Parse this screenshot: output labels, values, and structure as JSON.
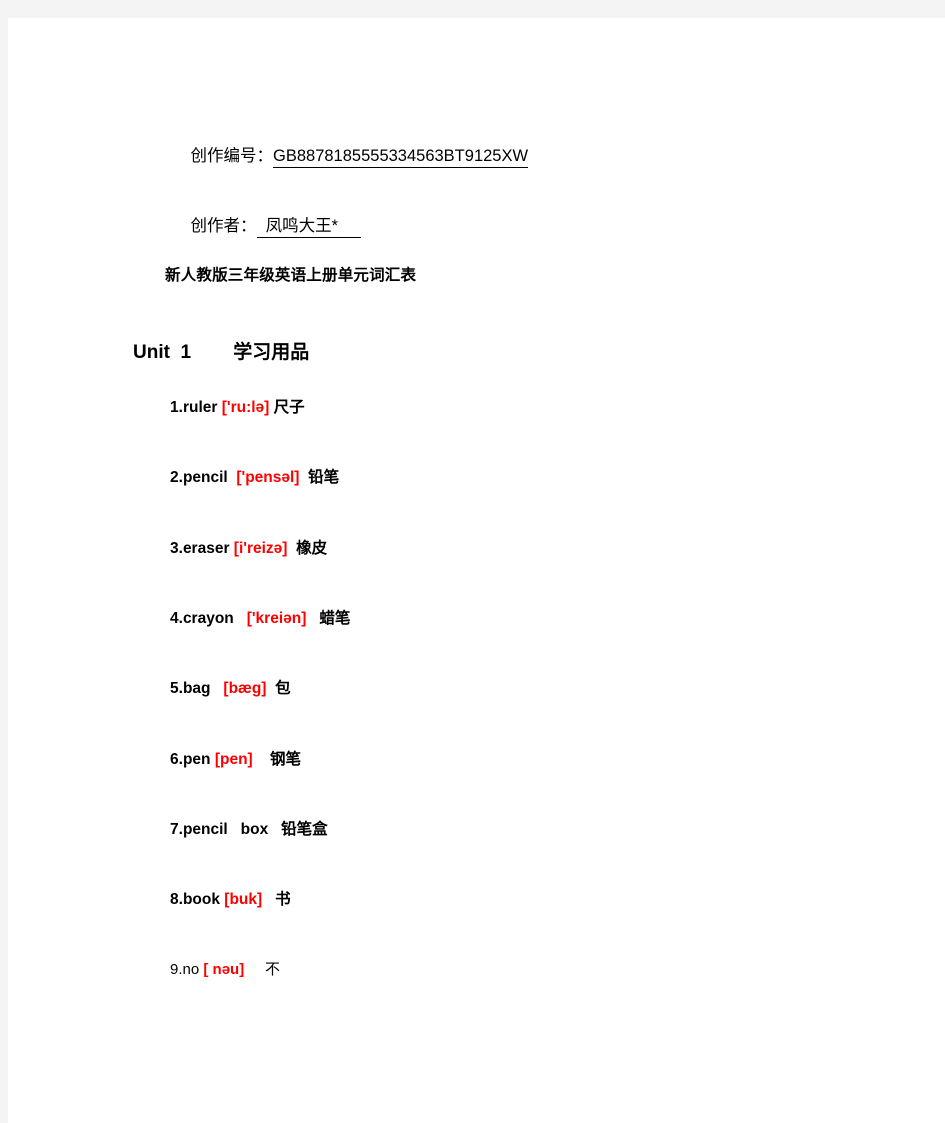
{
  "page": {
    "background_color": "#f4f4f4",
    "sheet_color": "#ffffff",
    "accent_color": "#ff0000",
    "text_color": "#000000"
  },
  "meta": {
    "creation_id_label": "创作编号：",
    "creation_id_value": "GB8878185555334563BT9125XW",
    "author_label": "创作者：",
    "author_value": "  凤鸣大王*     "
  },
  "title": "新人教版三年级英语上册单元词汇表",
  "unit": {
    "number_label": "Unit  1",
    "spacer": "        ",
    "topic": "学习用品"
  },
  "vocabulary": [
    {
      "index": "1.",
      "word": "ruler",
      "sep1": " ",
      "phonetic": "['ru:lə]",
      "sep2": " ",
      "gloss": "尺子",
      "bold": true
    },
    {
      "index": "2.",
      "word": "pencil",
      "sep1": "  ",
      "phonetic": "['pensəl]",
      "sep2": "  ",
      "gloss": "铅笔",
      "bold": true
    },
    {
      "index": "3.",
      "word": "eraser",
      "sep1": " ",
      "phonetic": "[i'reizə]",
      "sep2": "  ",
      "gloss": "橡皮",
      "bold": true
    },
    {
      "index": "4.",
      "word": "crayon",
      "sep1": "   ",
      "phonetic": "['kreiən]",
      "sep2": "   ",
      "gloss": "蜡笔",
      "bold": true
    },
    {
      "index": "5.",
      "word": "bag",
      "sep1": "   ",
      "phonetic": "[bæg]",
      "sep2": "  ",
      "gloss": "包",
      "bold": true
    },
    {
      "index": "6.",
      "word": "pen",
      "sep1": " ",
      "phonetic": "[pen]",
      "sep2": "    ",
      "gloss": "钢笔",
      "bold": true
    },
    {
      "index": "7.",
      "word": "pencil   box",
      "sep1": "",
      "phonetic": "",
      "sep2": "   ",
      "gloss": "铅笔盒",
      "bold": true
    },
    {
      "index": "8.",
      "word": "book",
      "sep1": " ",
      "phonetic": "[buk]",
      "sep2": "   ",
      "gloss": "书",
      "bold": true
    },
    {
      "index": "9.",
      "word": "no",
      "sep1": " ",
      "phonetic": "[ nəu]",
      "sep2": "     ",
      "gloss": "不",
      "bold": false
    }
  ]
}
